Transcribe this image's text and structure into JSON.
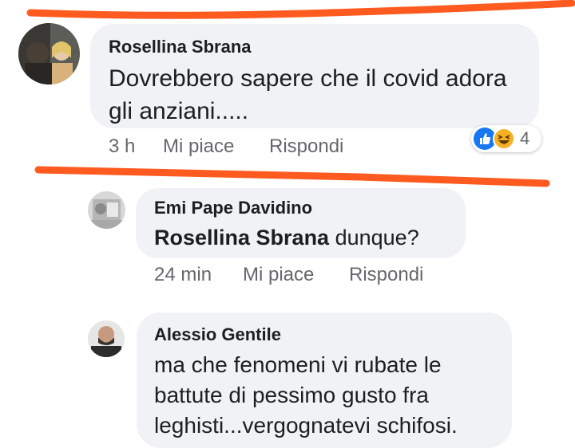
{
  "comments": [
    {
      "author": "Rosellina Sbrana",
      "text_line1": "Dovrebbero sapere che il covid adora",
      "text_line2": "gli anziani.....",
      "time": "3 h",
      "like_label": "Mi piace",
      "reply_label": "Rispondi",
      "reaction_count": "4",
      "reactions": [
        "like-icon",
        "haha-icon"
      ]
    },
    {
      "author": "Emi Pape Davidino",
      "mention": "Rosellina Sbrana",
      "text": "dunque?",
      "time": "24 min",
      "like_label": "Mi piace",
      "reply_label": "Rispondi"
    },
    {
      "author": "Alessio Gentile",
      "text_line1": "ma che fenomeni vi rubate le",
      "text_line2": "battute di pessimo gusto fra",
      "text_line3": "leghisti...vergognatevi schifosi."
    }
  ],
  "colors": {
    "bubble": "#f0f2f5",
    "highlight_stroke": "#ff5a1f",
    "like_blue": "#1877f2",
    "haha_yellow": "#f7b125",
    "meta_gray": "#65676b"
  }
}
